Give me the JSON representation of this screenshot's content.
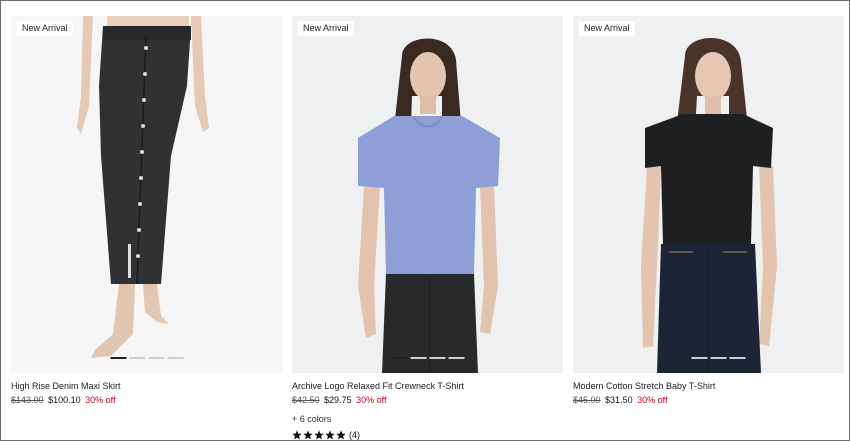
{
  "products": [
    {
      "badge": "New Arrival",
      "title": "High Rise Denim Maxi Skirt",
      "original_price": "$143.00",
      "sale_price": "$100.10",
      "discount": "30% off",
      "active_slide": 1,
      "slides": 4
    },
    {
      "badge": "New Arrival",
      "title": "Archive Logo Relaxed Fit Crewneck T-Shirt",
      "original_price": "$42.50",
      "sale_price": "$29.75",
      "discount": "30% off",
      "colors_note": "+ 6 colors",
      "rating_stars": 5,
      "review_count": "(4)",
      "active_slide": 1,
      "slides": 4
    },
    {
      "badge": "New Arrival",
      "title": "Modern Cotton Stretch Baby T-Shirt",
      "original_price": "$45.00",
      "sale_price": "$31.50",
      "discount": "30% off",
      "active_slide": 1,
      "slides": 4
    }
  ],
  "icons": {
    "rating": "star-icon"
  },
  "colors": {
    "discount": "#d0021b",
    "dot_active": "#222222",
    "dot_inactive": "#cfcfcf"
  }
}
